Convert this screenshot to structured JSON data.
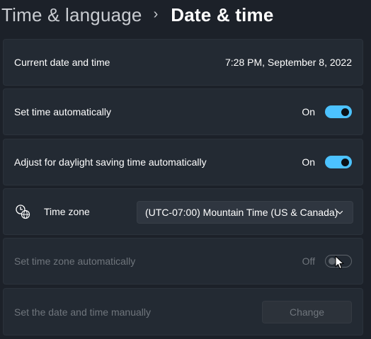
{
  "breadcrumb": {
    "parent": "Time & language",
    "separator": "›",
    "current": "Date & time"
  },
  "current_datetime": {
    "label": "Current date and time",
    "value": "7:28 PM, September 8, 2022"
  },
  "set_time_auto": {
    "label": "Set time automatically",
    "state_text": "On",
    "on": true
  },
  "daylight_saving": {
    "label": "Adjust for daylight saving time automatically",
    "state_text": "On",
    "on": true
  },
  "time_zone": {
    "label": "Time zone",
    "icon": "globe-clock-icon",
    "selected": "(UTC-07:00) Mountain Time (US & Canada)"
  },
  "set_timezone_auto": {
    "label": "Set time zone automatically",
    "state_text": "Off",
    "on": false,
    "disabled": true
  },
  "manual_datetime": {
    "label": "Set the date and time manually",
    "button_label": "Change",
    "disabled": true
  },
  "colors": {
    "accent": "#4cc2ff",
    "background": "#1c2129",
    "card": "#232a33",
    "disabled_text": "#6f757c"
  }
}
